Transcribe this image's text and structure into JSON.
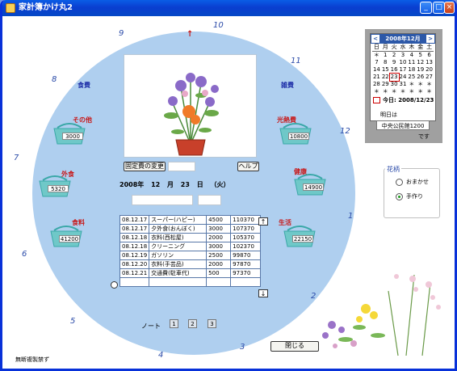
{
  "window": {
    "title": "家計簿かけ丸2"
  },
  "colors": {
    "clock_face": "#afcfef",
    "accent": "#2c58a8",
    "label_blue": "#1e2fa8",
    "label_red": "#c81818"
  },
  "clock_numbers": {
    "n9": "9",
    "n10": "10",
    "n11": "11",
    "n12": "12",
    "n1": "1",
    "n2": "2",
    "n3": "3",
    "n4": "4",
    "n5": "5",
    "n6": "6",
    "n7": "7",
    "n8": "8",
    "top_arrow": "↑"
  },
  "sections": {
    "shokuhi": "食費",
    "zatsuhi": "雑費",
    "sonota": "その他",
    "kounetsu": "光熱費",
    "gaishoku": "外食",
    "kenkou": "健康",
    "shokuryou": "食料",
    "seikatsu": "生活"
  },
  "amounts": {
    "sonota": "3000",
    "kounetsu": "10800",
    "gaishoku": "5320",
    "kenkou": "14900",
    "shokuryou": "41200",
    "seikatsu": "22150"
  },
  "buttons": {
    "fixed_change": "固定費の変更",
    "help": "ヘルプ",
    "close": "閉じる"
  },
  "date": {
    "year": "2008年",
    "month": "12",
    "month_unit": "月",
    "day": "23",
    "day_unit": "日",
    "weekday": "（火）"
  },
  "ledger": {
    "rows": [
      {
        "date": "08.12.17",
        "item": "スーパー(ハピー)",
        "amount": "4500",
        "balance": "110370"
      },
      {
        "date": "08.12.17",
        "item": "夕外食(おんぼく)",
        "amount": "3000",
        "balance": "107370"
      },
      {
        "date": "08.12.18",
        "item": "衣料(西松屋)",
        "amount": "2000",
        "balance": "105370"
      },
      {
        "date": "08.12.18",
        "item": "クリーニング",
        "amount": "3000",
        "balance": "102370"
      },
      {
        "date": "08.12.19",
        "item": "ガソリン",
        "amount": "2500",
        "balance": "99870"
      },
      {
        "date": "08.12.20",
        "item": "衣料(手芸品)",
        "amount": "2000",
        "balance": "97870"
      },
      {
        "date": "08.12.21",
        "item": "交通費(駐車代)",
        "amount": "500",
        "balance": "97370"
      },
      {
        "date": "",
        "item": "",
        "amount": "",
        "balance": ""
      }
    ],
    "scroll_up": "↑",
    "scroll_down": "↓"
  },
  "notes": {
    "label": "ノート",
    "n1": "1",
    "n2": "2",
    "n3": "3"
  },
  "footer": {
    "text": "無断複製禁ず"
  },
  "calendar": {
    "month_label": "2008年12月",
    "prev": "<",
    "next": ">",
    "dow": [
      "日",
      "月",
      "火",
      "水",
      "木",
      "金",
      "土"
    ],
    "days": [
      "＊",
      "1",
      "2",
      "3",
      "4",
      "5",
      "6",
      "7",
      "8",
      "9",
      "10",
      "11",
      "12",
      "13",
      "14",
      "15",
      "16",
      "17",
      "18",
      "19",
      "20",
      "21",
      "22",
      "23",
      "24",
      "25",
      "26",
      "27",
      "28",
      "29",
      "30",
      "31",
      "＊",
      "＊",
      "＊",
      "＊",
      "＊",
      "＊",
      "＊",
      "＊",
      "＊",
      "＊"
    ],
    "today_label": "今日: 2008/12/23"
  },
  "tomorrow": {
    "label": "明日は",
    "place": "中央公民館1200",
    "suffix": "です"
  },
  "kaki": {
    "title": "花柄",
    "option_auto": "おまかせ",
    "option_hand": "手作り",
    "selected": "手作り"
  }
}
